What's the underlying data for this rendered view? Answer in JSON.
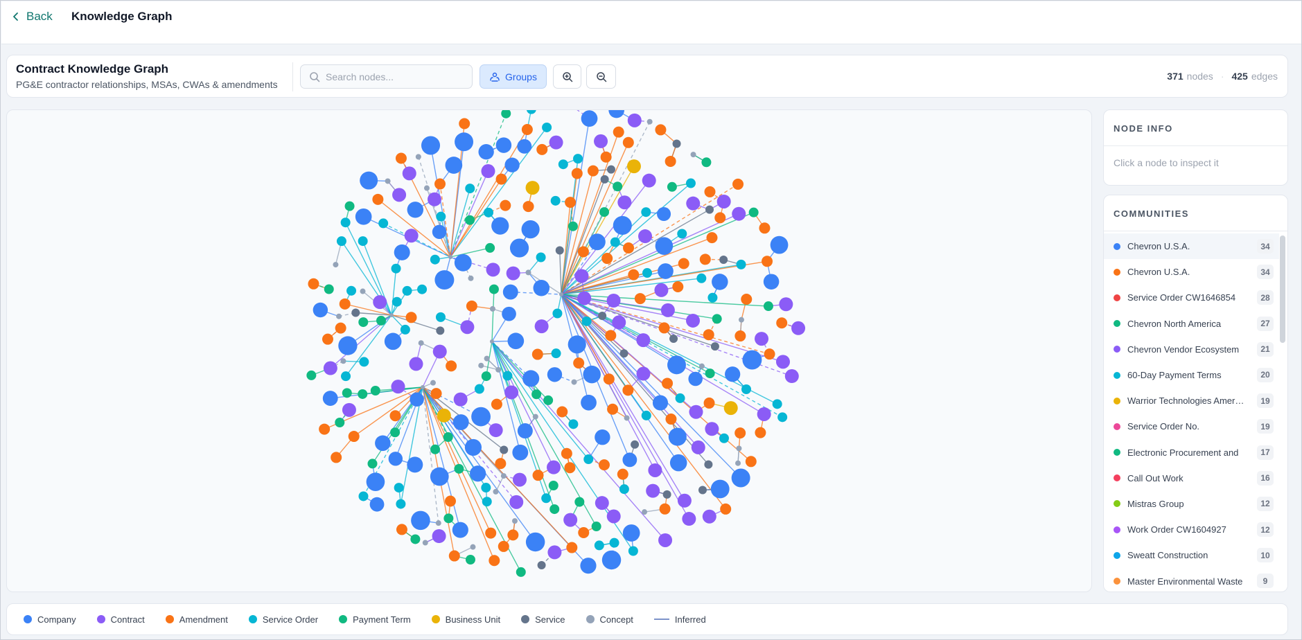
{
  "header": {
    "back_label": "Back",
    "title": "Knowledge Graph"
  },
  "toolbar": {
    "title": "Contract Knowledge Graph",
    "subtitle": "PG&E contractor relationships, MSAs, CWAs & amendments",
    "search_placeholder": "Search nodes...",
    "groups_label": "Groups",
    "nodes_count": "371",
    "nodes_label": "nodes",
    "edges_count": "425",
    "edges_label": "edges"
  },
  "node_info": {
    "heading": "NODE INFO",
    "placeholder": "Click a node to inspect it"
  },
  "communities": {
    "heading": "COMMUNITIES",
    "items": [
      {
        "name": "Chevron U.S.A.",
        "count": "34",
        "color": "#3b82f6"
      },
      {
        "name": "Chevron U.S.A.",
        "count": "34",
        "color": "#f97316"
      },
      {
        "name": "Service Order CW1646854",
        "count": "28",
        "color": "#ef4444"
      },
      {
        "name": "Chevron North America",
        "count": "27",
        "color": "#10b981"
      },
      {
        "name": "Chevron Vendor Ecosystem",
        "count": "21",
        "color": "#8b5cf6"
      },
      {
        "name": "60-Day Payment Terms",
        "count": "20",
        "color": "#06b6d4"
      },
      {
        "name": "Warrior Technologies Americas",
        "count": "19",
        "color": "#eab308"
      },
      {
        "name": "Service Order No.",
        "count": "19",
        "color": "#ec4899"
      },
      {
        "name": "Electronic Procurement and",
        "count": "17",
        "color": "#10b981"
      },
      {
        "name": "Call Out Work",
        "count": "16",
        "color": "#f43f5e"
      },
      {
        "name": "Mistras Group",
        "count": "12",
        "color": "#84cc16"
      },
      {
        "name": "Work Order CW1604927",
        "count": "12",
        "color": "#a855f7"
      },
      {
        "name": "Sweatt Construction",
        "count": "10",
        "color": "#0ea5e9"
      },
      {
        "name": "Master Environmental Waste",
        "count": "9",
        "color": "#fb923c"
      }
    ]
  },
  "legend": [
    {
      "label": "Company",
      "color": "#3b82f6",
      "icon": "circle"
    },
    {
      "label": "Contract",
      "color": "#8b5cf6",
      "icon": "circle"
    },
    {
      "label": "Amendment",
      "color": "#f97316",
      "icon": "circle"
    },
    {
      "label": "Service Order",
      "color": "#06b6d4",
      "icon": "circle"
    },
    {
      "label": "Payment Term",
      "color": "#10b981",
      "icon": "circle"
    },
    {
      "label": "Business Unit",
      "color": "#eab308",
      "icon": "circle"
    },
    {
      "label": "Service",
      "color": "#64748b",
      "icon": "circle"
    },
    {
      "label": "Concept",
      "color": "#94a3b8",
      "icon": "circle"
    },
    {
      "label": "Inferred",
      "color": "#7c93c9",
      "icon": "line"
    }
  ]
}
